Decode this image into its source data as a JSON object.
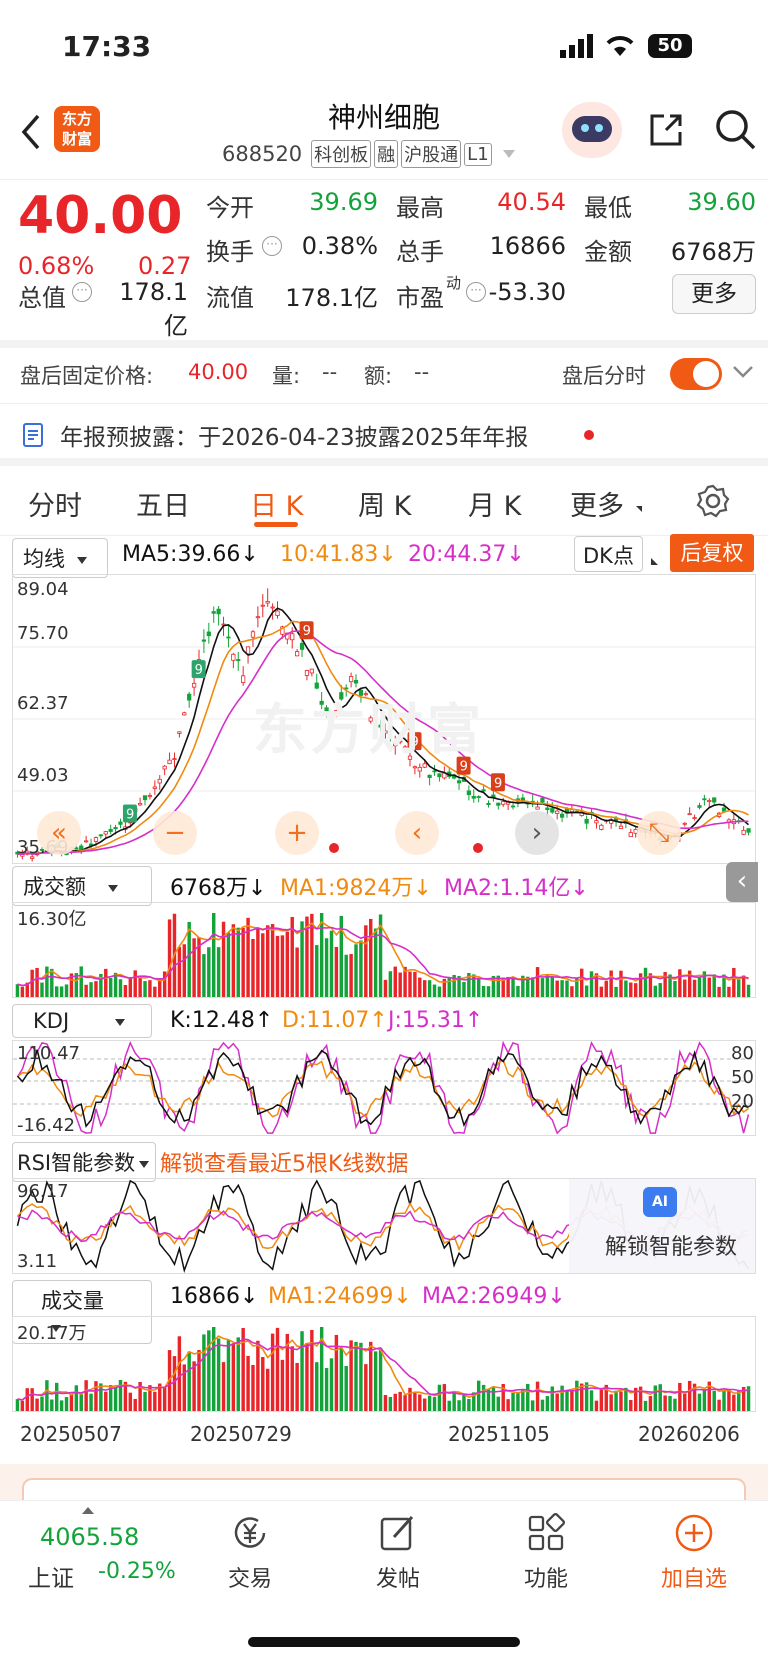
{
  "status_bar": {
    "time": "17:33",
    "battery": "50"
  },
  "header": {
    "title": "神州细胞",
    "code": "688520",
    "tags": [
      "科创板",
      "融",
      "沪股通",
      "L1"
    ],
    "logo_text_line1": "东方",
    "logo_text_line2": "财富"
  },
  "quote": {
    "price": "40.00",
    "change_pct": "0.68%",
    "change": "0.27",
    "open_label": "今开",
    "open": "39.69",
    "high_label": "最高",
    "high": "40.54",
    "low_label": "最低",
    "low": "39.60",
    "turnover_label": "换手",
    "turnover": "0.38%",
    "volume_label": "总手",
    "volume": "16866",
    "amount_label": "金额",
    "amount": "6768万",
    "mktcap_label": "总值",
    "mktcap": "178.1亿",
    "float_label": "流值",
    "float": "178.1亿",
    "pe_label": "市盈",
    "pe_sup": "动",
    "pe": "-53.30",
    "more_button": "更多"
  },
  "after_hours": {
    "label": "盘后固定价格:",
    "price": "40.00",
    "vol_label": "量:",
    "vol": "--",
    "amt_label": "额:",
    "amt": "--",
    "toggle_label": "盘后分时",
    "toggle_on": true
  },
  "notice": {
    "text": "年报预披露：于2026-04-23披露2025年年报"
  },
  "tabs": [
    {
      "label": "分时"
    },
    {
      "label": "五日"
    },
    {
      "label": "日 K",
      "active": true
    },
    {
      "label": "周 K"
    },
    {
      "label": "月 K"
    },
    {
      "label": "更多"
    }
  ],
  "kline_panel": {
    "indicator_select": "均线",
    "ma5": "MA5:39.66↓",
    "ma10": "10:41.83↓",
    "ma20": "20:44.37↓",
    "dk_button": "DK点",
    "adjust_button": "后复权",
    "y_labels": [
      "89.04",
      "75.70",
      "62.37",
      "49.03",
      "35.69"
    ],
    "watermark": "东方财富"
  },
  "amount_panel": {
    "select": "成交额",
    "value": "6768万↓",
    "ma1": "MA1:9824万↓",
    "ma2": "MA2:1.14亿↓",
    "y_top": "16.30亿"
  },
  "kdj_panel": {
    "select": "KDJ",
    "k": "K:12.48↑",
    "d": "D:11.07↑",
    "j": "J:15.31↑",
    "y_top": "110.47",
    "y_bottom": "-16.42",
    "right_labels": [
      "80",
      "50",
      "20"
    ]
  },
  "rsi_panel": {
    "select": "RSI智能参数",
    "unlock_text": "解锁查看最近5根K线数据",
    "y_top": "96.17",
    "y_bottom": "3.11",
    "unlock_button": "解锁智能参数",
    "ai_badge": "AI"
  },
  "volume_panel": {
    "select": "成交量",
    "value": "16866↓",
    "ma1": "MA1:24699↓",
    "ma2": "MA2:26949↓",
    "y_top": "20.17万"
  },
  "x_dates": [
    "20250507",
    "20250729",
    "20251105",
    "20260206"
  ],
  "bottom_nav": {
    "index_value": "4065.58",
    "index_name": "上证",
    "index_change": "-0.25%",
    "items": [
      "交易",
      "发帖",
      "功能",
      "加自选"
    ]
  },
  "colors": {
    "up": "#e8262a",
    "down": "#14a33a",
    "accent": "#f05a14",
    "ma10": "#f08a10",
    "ma20": "#d62fc9"
  },
  "chart_data": {
    "type": "line",
    "title": "",
    "x": [
      "20250507",
      "20250729",
      "20251105",
      "20260206"
    ],
    "ylim": [
      35.69,
      89.04
    ],
    "series": [
      {
        "name": "MA5",
        "values": [
          36,
          38,
          48,
          82,
          72,
          62,
          52,
          47,
          45,
          43,
          41,
          40,
          46,
          41,
          39.66
        ]
      },
      {
        "name": "10",
        "values": [
          36,
          37,
          45,
          78,
          74,
          64,
          54,
          48,
          46,
          44,
          42,
          41,
          44,
          42,
          41.83
        ]
      },
      {
        "name": "20",
        "values": [
          36,
          37,
          42,
          70,
          75,
          66,
          57,
          51,
          48,
          46,
          44,
          42,
          43,
          43,
          44.37
        ]
      }
    ]
  }
}
